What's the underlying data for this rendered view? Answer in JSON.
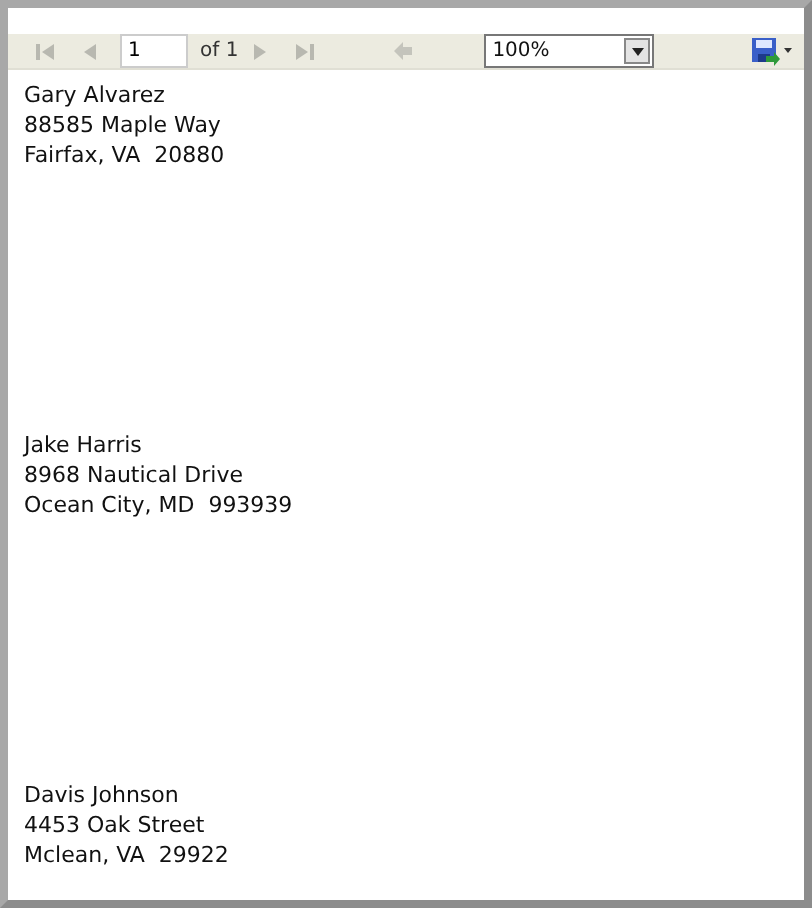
{
  "toolbar": {
    "page_number": "1",
    "page_count": "of 1",
    "zoom": "100%"
  },
  "labels": [
    {
      "lines": [
        "Gary Alvarez",
        "88585 Maple Way",
        "Fairfax, VA  20880"
      ]
    },
    {
      "lines": [
        "Jake Harris",
        "8968 Nautical Drive",
        "Ocean City, MD  993939"
      ]
    },
    {
      "lines": [
        "Davis Johnson",
        "4453 Oak Street",
        "Mclean, VA  29922"
      ]
    }
  ]
}
